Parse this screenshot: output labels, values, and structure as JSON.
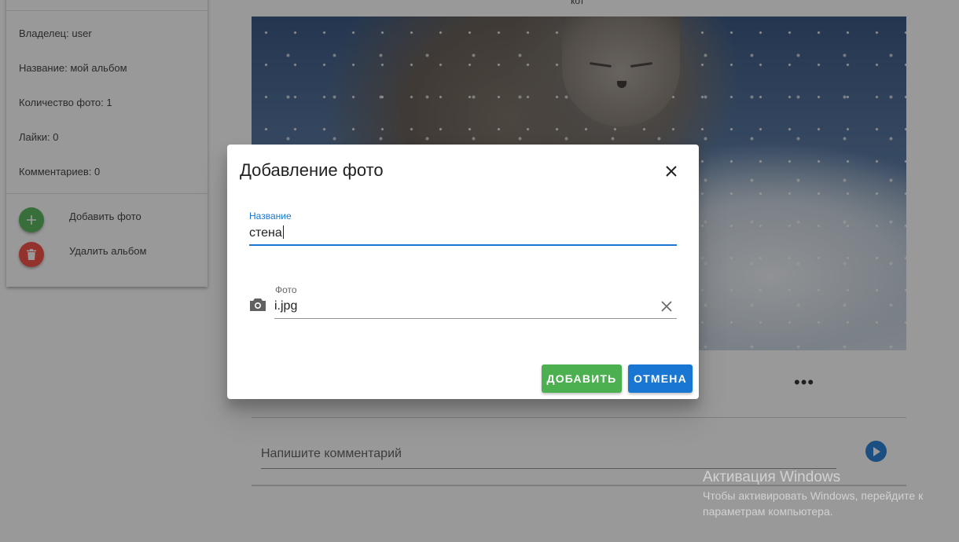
{
  "album": {
    "owner": "Владелец: user",
    "name": "Название: мой альбом",
    "photo_count": "Количество фото: 1",
    "likes": "Лайки: 0",
    "comments": "Комментариев: 0"
  },
  "actions": {
    "add_photo": "Добавить фото",
    "delete_album": "Удалить альбом"
  },
  "photo": {
    "title": "кот"
  },
  "comment": {
    "placeholder": "Напишите комментарий"
  },
  "more_icon": "more-horizontal-icon",
  "dialog": {
    "title": "Добавление фото",
    "name_label": "Название",
    "name_value": "стена",
    "photo_label": "Фото",
    "photo_value": "i.jpg",
    "add_button": "ДОБАВИТЬ",
    "cancel_button": "ОТМЕНА"
  },
  "watermark": {
    "title": "Активация Windows",
    "subtitle": "Чтобы активировать Windows, перейдите к параметрам компьютера."
  },
  "colors": {
    "add_green": "#4caf50",
    "delete_red": "#f44336",
    "primary_blue": "#1976d2",
    "overlay": "rgba(33,33,33,0.46)"
  }
}
